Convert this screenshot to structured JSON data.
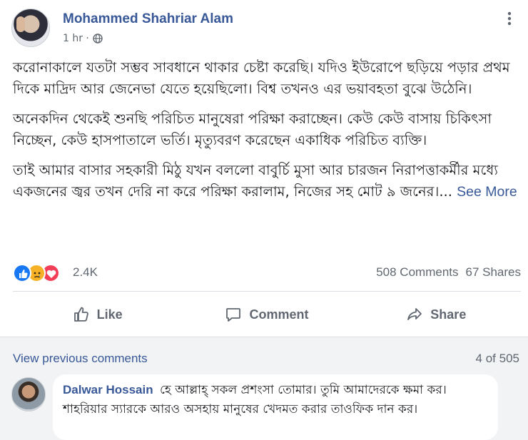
{
  "post": {
    "author": "Mohammed Shahriar Alam",
    "time": "1 hr ·",
    "privacy_icon": "globe-icon",
    "more_icon": "more-options-icon",
    "paragraphs": [
      "করোনাকালে যতটা সম্ভব সাবধানে থাকার চেষ্টা করেছি। যদিও ইউরোপে ছড়িয়ে পড়ার প্রথম দিকে মাদ্রিদ আর জেনেভা যেতে হয়েছিলো। বিশ্ব তখনও এর ভয়াবহতা বুঝে উঠেনি।",
      "অনেকদিন থেকেই শুনছি পরিচিত মানুষেরা পরিক্ষা করাচ্ছেন। কেউ কেউ বাসায় চিকিৎসা নিচ্ছেন, কেউ হাসপাতালে ভর্তি। মৃত্যুবরণ করেছেন একাধিক পরিচিত ব্যক্তি।",
      "তাই আমার বাসার সহকারী মিঠু যখন বললো বাবুর্চি মুসা আর চারজন নিরাপত্তাকর্মীর মধ্যে একজনের জ্বর তখন দেরি না করে পরিক্ষা করালাম, নিজের সহ মোট ৯ জনের।..."
    ],
    "see_more": "See More"
  },
  "reactions": {
    "icons": [
      "like-reaction-icon",
      "sad-reaction-icon",
      "love-reaction-icon"
    ],
    "count": "2.4K",
    "comments": "508 Comments",
    "shares": "67 Shares"
  },
  "actions": {
    "like": "Like",
    "comment": "Comment",
    "share": "Share"
  },
  "comments": {
    "view_previous": "View previous comments",
    "count": "4 of 505",
    "items": [
      {
        "author": "Dalwar Hossain",
        "text": "হে আল্লাহ্ সকল প্রশংসা তোমার। তুমি আমাদেরকে ক্ষমা কর। শাহরিয়ার স্যারকে আরও অসহায় মানুষের খেদমত করার তাওফিক দান কর।"
      }
    ]
  },
  "colors": {
    "link": "#385898",
    "secondary_text": "#606770",
    "like_blue": "#1877f2",
    "sad_yellow": "#f7b125",
    "love_red": "#f33e58",
    "comment_bg": "#f2f3f5"
  }
}
